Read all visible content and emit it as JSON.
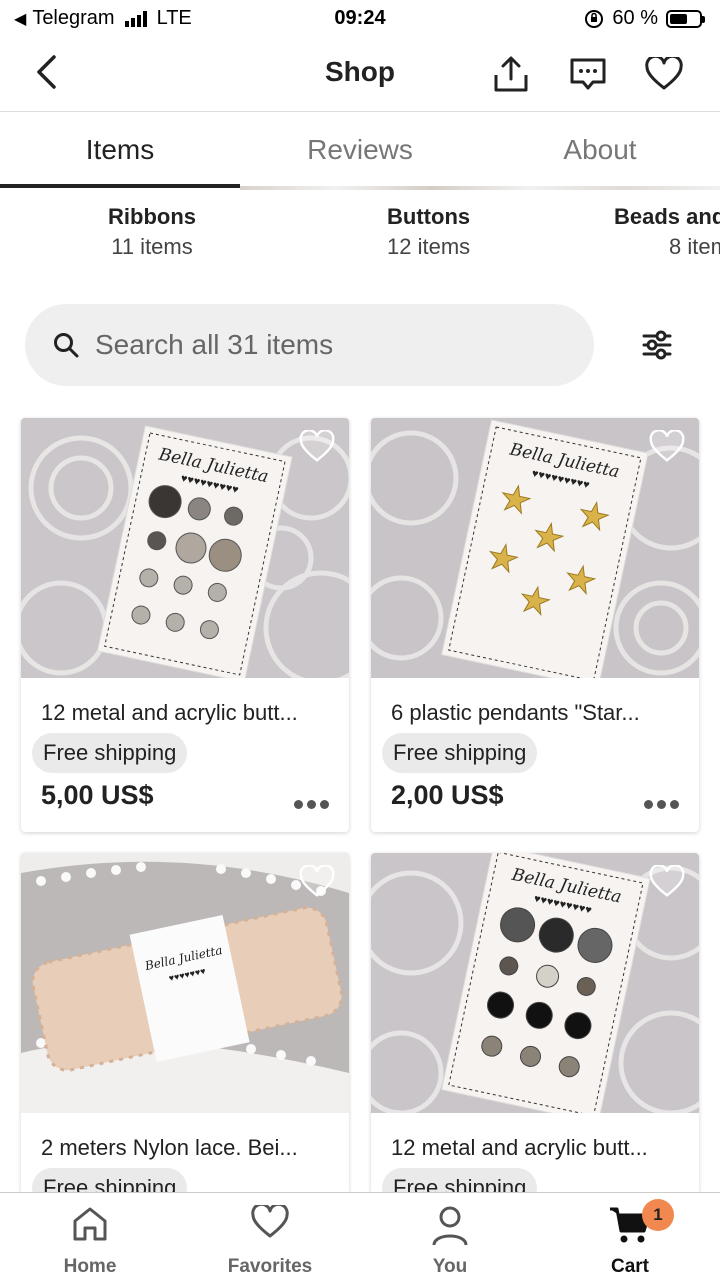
{
  "status_bar": {
    "app": "Telegram",
    "network": "LTE",
    "time": "09:24",
    "battery": "60 %",
    "battery_level": 0.6
  },
  "header": {
    "title": "Shop",
    "icons": [
      "back-chevron-icon",
      "share-icon",
      "message-icon",
      "heart-icon"
    ]
  },
  "tabs": [
    {
      "label": "Items",
      "active": true
    },
    {
      "label": "Reviews",
      "active": false
    },
    {
      "label": "About",
      "active": false
    }
  ],
  "categories": [
    {
      "name": "Ribbons",
      "count": "11 items"
    },
    {
      "name": "Buttons",
      "count": "12 items"
    },
    {
      "name": "Beads and",
      "count": "8 item"
    }
  ],
  "search": {
    "placeholder": "Search all 31 items"
  },
  "listings": [
    {
      "title": "12 metal and acrylic butt...",
      "badge": "Free shipping",
      "price": "5,00 US$",
      "image_text": "Bella Julietta"
    },
    {
      "title": "6 plastic pendants \"Star...",
      "badge": "Free shipping",
      "price": "2,00 US$",
      "image_text": "Bella Julietta"
    },
    {
      "title": "2 meters Nylon lace. Bei...",
      "badge": "Free shipping",
      "price": "",
      "image_text": "Bella Julietta"
    },
    {
      "title": "12 metal and acrylic butt...",
      "badge": "Free shipping",
      "price": "",
      "image_text": "Bella Julietta"
    }
  ],
  "bottom_nav": [
    {
      "label": "Home",
      "icon": "home-icon"
    },
    {
      "label": "Favorites",
      "icon": "heart-icon"
    },
    {
      "label": "You",
      "icon": "user-icon"
    },
    {
      "label": "Cart",
      "icon": "cart-icon",
      "active": true
    }
  ],
  "cart_badge": "1",
  "colors": {
    "accent_badge": "#f1884f",
    "search_bg": "#efefef",
    "pill_bg": "#eaeaea"
  }
}
